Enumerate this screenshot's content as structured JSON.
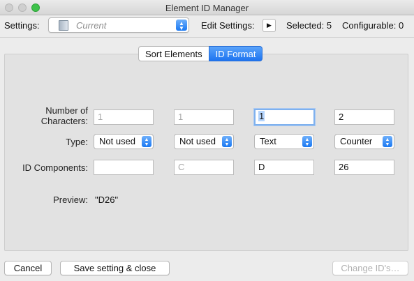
{
  "window": {
    "title": "Element ID Manager"
  },
  "toolbar": {
    "settings_label": "Settings:",
    "settings_value": "Current",
    "edit_settings_label": "Edit Settings:",
    "selected_text": "Selected: 5",
    "configurable_text": "Configurable: 0"
  },
  "tabs": [
    {
      "label": "Sort Elements",
      "active": false
    },
    {
      "label": "ID Format",
      "active": true
    }
  ],
  "form": {
    "row_labels": {
      "chars_line1": "Number of",
      "chars_line2": "Characters:",
      "type": "Type:",
      "components": "ID Components:",
      "preview": "Preview:"
    },
    "columns": [
      {
        "chars": "1",
        "type": "Not used",
        "component": ""
      },
      {
        "chars": "1",
        "type": "Not used",
        "component": "C"
      },
      {
        "chars": "1",
        "type": "Text",
        "component": "D"
      },
      {
        "chars": "2",
        "type": "Counter",
        "component": "26"
      }
    ],
    "preview_value": "\"D26\""
  },
  "footer": {
    "cancel": "Cancel",
    "save_close": "Save setting & close",
    "change_ids": "Change ID's…"
  },
  "colors": {
    "accent": "#1d74f0",
    "focus_ring": "#7fb1ee"
  }
}
